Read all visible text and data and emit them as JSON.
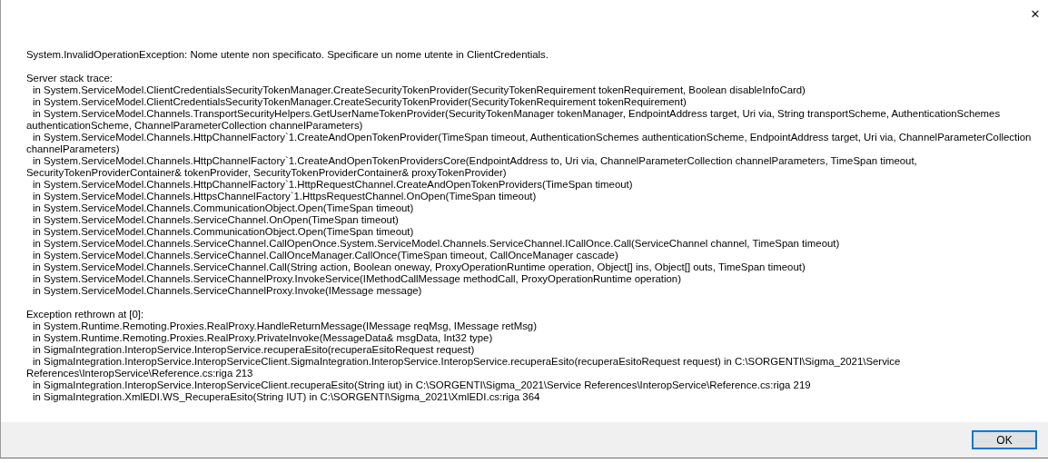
{
  "close_glyph": "✕",
  "paragraphs": [
    {
      "lines": [
        {
          "kind": "plain",
          "text": "System.InvalidOperationException: Nome utente non specificato. Specificare un nome utente in ClientCredentials."
        }
      ]
    },
    {
      "lines": [
        {
          "kind": "plain",
          "text": "Server stack trace:"
        },
        {
          "kind": "frame",
          "text": "in System.ServiceModel.ClientCredentialsSecurityTokenManager.CreateSecurityTokenProvider(SecurityTokenRequirement tokenRequirement, Boolean disableInfoCard)"
        },
        {
          "kind": "frame",
          "text": "in System.ServiceModel.ClientCredentialsSecurityTokenManager.CreateSecurityTokenProvider(SecurityTokenRequirement tokenRequirement)"
        },
        {
          "kind": "frame",
          "text": "in System.ServiceModel.Channels.TransportSecurityHelpers.GetUserNameTokenProvider(SecurityTokenManager tokenManager, EndpointAddress target, Uri via, String transportScheme, AuthenticationSchemes"
        },
        {
          "kind": "plain",
          "text": "authenticationScheme, ChannelParameterCollection channelParameters)"
        },
        {
          "kind": "frame",
          "text": "in System.ServiceModel.Channels.HttpChannelFactory`1.CreateAndOpenTokenProvider(TimeSpan timeout, AuthenticationSchemes authenticationScheme, EndpointAddress target, Uri via, ChannelParameterCollection"
        },
        {
          "kind": "plain",
          "text": "channelParameters)"
        },
        {
          "kind": "frame",
          "text": "in System.ServiceModel.Channels.HttpChannelFactory`1.CreateAndOpenTokenProvidersCore(EndpointAddress to, Uri via, ChannelParameterCollection channelParameters, TimeSpan timeout,"
        },
        {
          "kind": "plain",
          "text": "SecurityTokenProviderContainer& tokenProvider, SecurityTokenProviderContainer& proxyTokenProvider)"
        },
        {
          "kind": "frame",
          "text": "in System.ServiceModel.Channels.HttpChannelFactory`1.HttpRequestChannel.CreateAndOpenTokenProviders(TimeSpan timeout)"
        },
        {
          "kind": "frame",
          "text": "in System.ServiceModel.Channels.HttpsChannelFactory`1.HttpsRequestChannel.OnOpen(TimeSpan timeout)"
        },
        {
          "kind": "frame",
          "text": "in System.ServiceModel.Channels.CommunicationObject.Open(TimeSpan timeout)"
        },
        {
          "kind": "frame",
          "text": "in System.ServiceModel.Channels.ServiceChannel.OnOpen(TimeSpan timeout)"
        },
        {
          "kind": "frame",
          "text": "in System.ServiceModel.Channels.CommunicationObject.Open(TimeSpan timeout)"
        },
        {
          "kind": "frame",
          "text": "in System.ServiceModel.Channels.ServiceChannel.CallOpenOnce.System.ServiceModel.Channels.ServiceChannel.ICallOnce.Call(ServiceChannel channel, TimeSpan timeout)"
        },
        {
          "kind": "frame",
          "text": "in System.ServiceModel.Channels.ServiceChannel.CallOnceManager.CallOnce(TimeSpan timeout, CallOnceManager cascade)"
        },
        {
          "kind": "frame",
          "text": "in System.ServiceModel.Channels.ServiceChannel.Call(String action, Boolean oneway, ProxyOperationRuntime operation, Object[] ins, Object[] outs, TimeSpan timeout)"
        },
        {
          "kind": "frame",
          "text": "in System.ServiceModel.Channels.ServiceChannelProxy.InvokeService(IMethodCallMessage methodCall, ProxyOperationRuntime operation)"
        },
        {
          "kind": "frame",
          "text": "in System.ServiceModel.Channels.ServiceChannelProxy.Invoke(IMessage message)"
        }
      ]
    },
    {
      "lines": [
        {
          "kind": "plain",
          "text": "Exception rethrown at [0]:"
        },
        {
          "kind": "frame",
          "text": "in System.Runtime.Remoting.Proxies.RealProxy.HandleReturnMessage(IMessage reqMsg, IMessage retMsg)"
        },
        {
          "kind": "frame",
          "text": "in System.Runtime.Remoting.Proxies.RealProxy.PrivateInvoke(MessageData& msgData, Int32 type)"
        },
        {
          "kind": "frame",
          "text": "in SigmaIntegration.InteropService.InteropService.recuperaEsito(recuperaEsitoRequest request)"
        },
        {
          "kind": "frame",
          "text": "in SigmaIntegration.InteropService.InteropServiceClient.SigmaIntegration.InteropService.InteropService.recuperaEsito(recuperaEsitoRequest request) in C:\\SORGENTI\\Sigma_2021\\Service"
        },
        {
          "kind": "plain",
          "text": "References\\InteropService\\Reference.cs:riga 213"
        },
        {
          "kind": "frame",
          "text": "in SigmaIntegration.InteropService.InteropServiceClient.recuperaEsito(String iut) in C:\\SORGENTI\\Sigma_2021\\Service References\\InteropService\\Reference.cs:riga 219"
        },
        {
          "kind": "frame",
          "text": "in SigmaIntegration.XmlEDI.WS_RecuperaEsito(String IUT) in C:\\SORGENTI\\Sigma_2021\\XmlEDI.cs:riga 364"
        }
      ]
    }
  ],
  "buttons": [
    {
      "label": "OK",
      "selected": true
    }
  ]
}
